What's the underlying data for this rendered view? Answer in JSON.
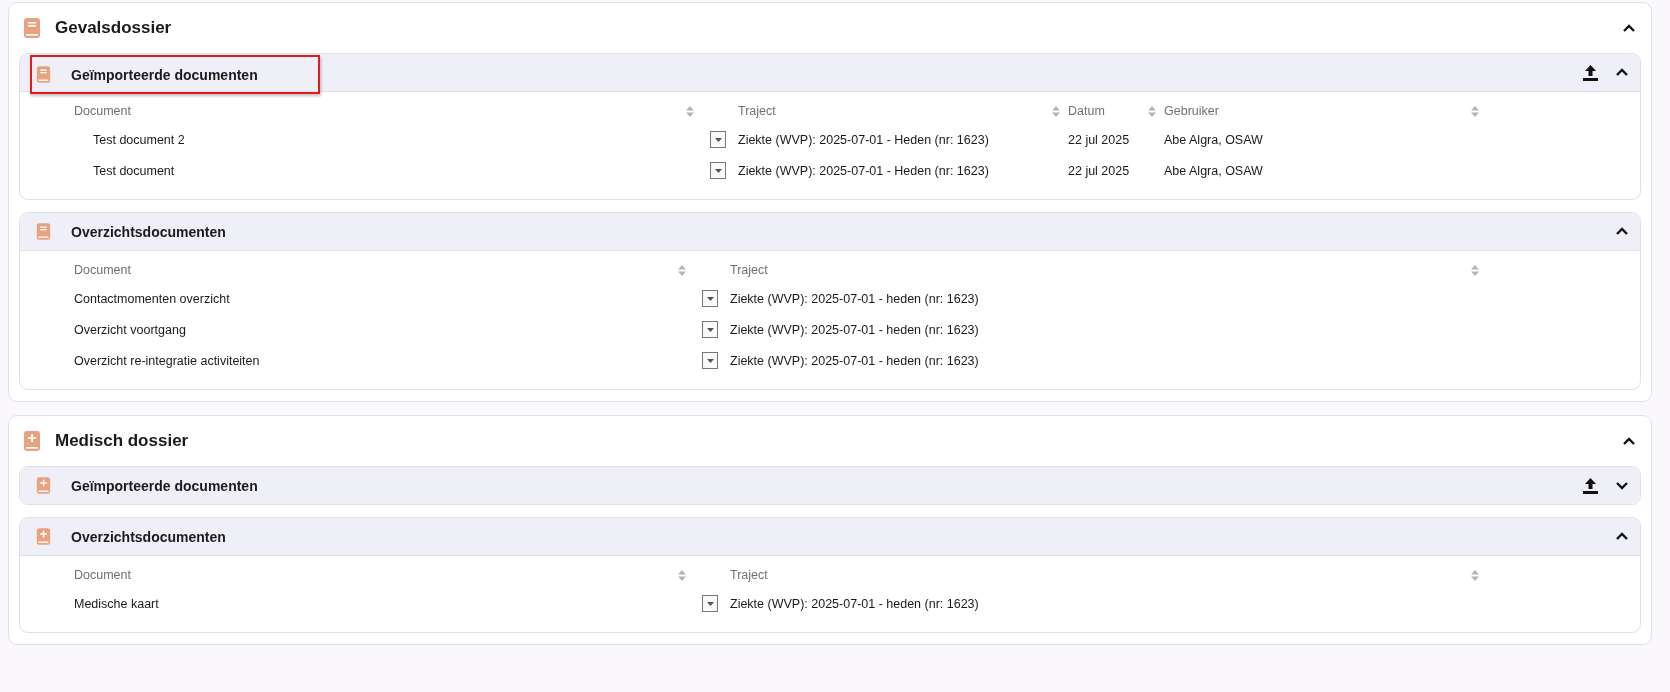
{
  "dossiers": [
    {
      "title": "Gevalsdossier",
      "kind": "book",
      "expanded": true,
      "panels": [
        {
          "title": "Geïmporteerde documenten",
          "expanded": true,
          "upload": true,
          "highlighted": true,
          "indented": true,
          "columns": [
            "Document",
            "Traject",
            "Datum",
            "Gebruiker"
          ],
          "rows": [
            {
              "cells": [
                "Test document 2",
                "Ziekte (WVP): 2025-07-01 - Heden (nr: 1623)",
                "22 jul 2025",
                "Abe Algra, OSAW"
              ]
            },
            {
              "cells": [
                "Test document",
                "Ziekte (WVP): 2025-07-01 - Heden (nr: 1623)",
                "22 jul 2025",
                "Abe Algra, OSAW"
              ]
            }
          ]
        },
        {
          "title": "Overzichtsdocumenten",
          "expanded": true,
          "upload": false,
          "highlighted": false,
          "indented": false,
          "columns": [
            "Document",
            "Traject"
          ],
          "rows": [
            {
              "cells": [
                "Contactmomenten overzicht",
                "Ziekte (WVP): 2025-07-01 - heden (nr: 1623)"
              ]
            },
            {
              "cells": [
                "Overzicht voortgang",
                "Ziekte (WVP): 2025-07-01 - heden (nr: 1623)"
              ]
            },
            {
              "cells": [
                "Overzicht re-integratie activiteiten",
                "Ziekte (WVP): 2025-07-01 - heden (nr: 1623)"
              ]
            }
          ]
        }
      ]
    },
    {
      "title": "Medisch dossier",
      "kind": "medical",
      "expanded": true,
      "panels": [
        {
          "title": "Geïmporteerde documenten",
          "expanded": false,
          "upload": true,
          "highlighted": false,
          "indented": false
        },
        {
          "title": "Overzichtsdocumenten",
          "expanded": true,
          "upload": false,
          "highlighted": false,
          "indented": false,
          "columns": [
            "Document",
            "Traject"
          ],
          "rows": [
            {
              "cells": [
                "Medische kaart",
                "Ziekte (WVP): 2025-07-01 - heden (nr: 1623)"
              ]
            }
          ]
        }
      ]
    }
  ]
}
